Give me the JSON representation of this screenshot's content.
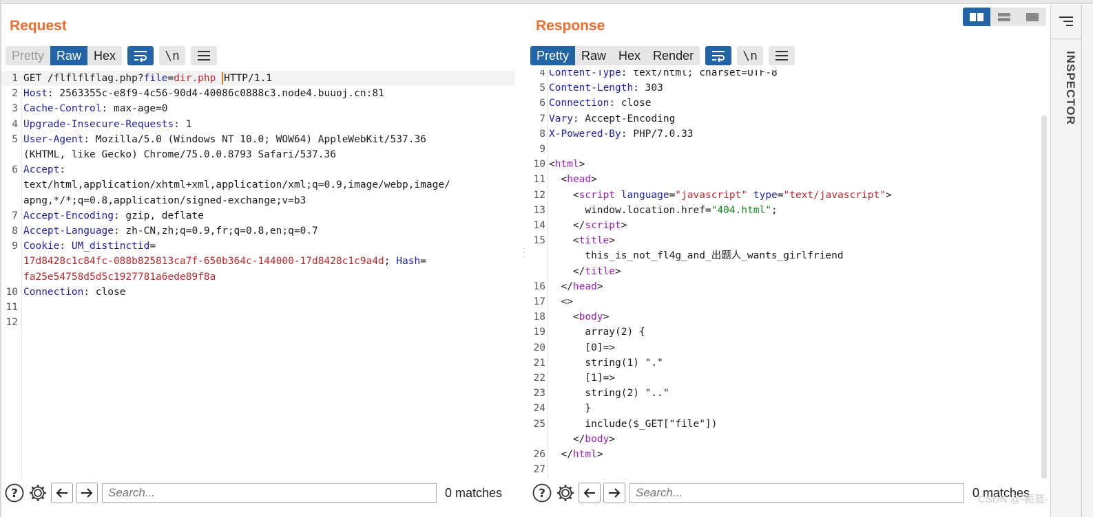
{
  "request": {
    "title": "Request",
    "tabs": [
      "Pretty",
      "Raw",
      "Hex"
    ],
    "active_tab": "Raw",
    "wrap_icon": "wrap-lines-icon",
    "newline_label": "\\n",
    "menu_icon": "hamburger-menu-icon",
    "search_placeholder": "Search...",
    "matches": "0 matches",
    "lines": [
      {
        "n": "1",
        "parts": [
          {
            "c": "",
            "t": "GET /flflflflag.php?"
          },
          {
            "c": "k",
            "t": "file"
          },
          {
            "c": "",
            "t": "="
          },
          {
            "c": "v",
            "t": "dir.php "
          },
          {
            "c": "cursor",
            "t": ""
          },
          {
            "c": "",
            "t": "HTTP/1.1"
          }
        ]
      },
      {
        "n": "2",
        "parts": [
          {
            "c": "k",
            "t": "Host"
          },
          {
            "c": "",
            "t": ": 2563355c-e8f9-4c56-90d4-40086c0888c3.node4.buuoj.cn:81"
          }
        ]
      },
      {
        "n": "3",
        "parts": [
          {
            "c": "k",
            "t": "Cache-Control"
          },
          {
            "c": "",
            "t": ": max-age=0"
          }
        ]
      },
      {
        "n": "4",
        "parts": [
          {
            "c": "k",
            "t": "Upgrade-Insecure-Requests"
          },
          {
            "c": "",
            "t": ": 1"
          }
        ]
      },
      {
        "n": "5",
        "parts": [
          {
            "c": "k",
            "t": "User-Agent"
          },
          {
            "c": "",
            "t": ": Mozilla/5.0 (Windows NT 10.0; WOW64) AppleWebKit/537.36"
          }
        ]
      },
      {
        "n": "",
        "parts": [
          {
            "c": "",
            "t": "(KHTML, like Gecko) Chrome/75.0.0.8793 Safari/537.36"
          }
        ]
      },
      {
        "n": "6",
        "parts": [
          {
            "c": "k",
            "t": "Accept"
          },
          {
            "c": "",
            "t": ":"
          }
        ]
      },
      {
        "n": "",
        "parts": [
          {
            "c": "",
            "t": "text/html,application/xhtml+xml,application/xml;q=0.9,image/webp,image/"
          }
        ]
      },
      {
        "n": "",
        "parts": [
          {
            "c": "",
            "t": "apng,*/*;q=0.8,application/signed-exchange;v=b3"
          }
        ]
      },
      {
        "n": "7",
        "parts": [
          {
            "c": "k",
            "t": "Accept-Encoding"
          },
          {
            "c": "",
            "t": ": gzip, deflate"
          }
        ]
      },
      {
        "n": "8",
        "parts": [
          {
            "c": "k",
            "t": "Accept-Language"
          },
          {
            "c": "",
            "t": ": zh-CN,zh;q=0.9,fr;q=0.8,en;q=0.7"
          }
        ]
      },
      {
        "n": "9",
        "parts": [
          {
            "c": "k",
            "t": "Cookie"
          },
          {
            "c": "",
            "t": ": "
          },
          {
            "c": "k",
            "t": "UM_distinctid"
          },
          {
            "c": "",
            "t": "="
          }
        ]
      },
      {
        "n": "",
        "parts": [
          {
            "c": "v",
            "t": "17d8428c1c84fc-088b825813ca7f-650b364c-144000-17d8428c1c9a4d"
          },
          {
            "c": "",
            "t": "; "
          },
          {
            "c": "k",
            "t": "Hash"
          },
          {
            "c": "",
            "t": "="
          }
        ]
      },
      {
        "n": "",
        "parts": [
          {
            "c": "v",
            "t": "fa25e54758d5d5c1927781a6ede89f8a"
          }
        ]
      },
      {
        "n": "10",
        "parts": [
          {
            "c": "k",
            "t": "Connection"
          },
          {
            "c": "",
            "t": ": close"
          }
        ]
      },
      {
        "n": "11",
        "parts": []
      },
      {
        "n": "12",
        "parts": []
      }
    ]
  },
  "response": {
    "title": "Response",
    "tabs": [
      "Pretty",
      "Raw",
      "Hex",
      "Render"
    ],
    "active_tab": "Pretty",
    "wrap_icon": "wrap-lines-icon",
    "newline_label": "\\n",
    "menu_icon": "hamburger-menu-icon",
    "search_placeholder": "Search...",
    "matches": "0 matches",
    "lines": [
      {
        "n": "4",
        "parts": [
          {
            "c": "k",
            "t": "Content-Type"
          },
          {
            "c": "",
            "t": ": text/html; charset=UTF-8"
          }
        ]
      },
      {
        "n": "5",
        "parts": [
          {
            "c": "k",
            "t": "Content-Length"
          },
          {
            "c": "",
            "t": ": 303"
          }
        ]
      },
      {
        "n": "6",
        "parts": [
          {
            "c": "k",
            "t": "Connection"
          },
          {
            "c": "",
            "t": ": close"
          }
        ]
      },
      {
        "n": "7",
        "parts": [
          {
            "c": "k",
            "t": "Vary"
          },
          {
            "c": "",
            "t": ": Accept-Encoding"
          }
        ]
      },
      {
        "n": "8",
        "parts": [
          {
            "c": "k",
            "t": "X-Powered-By"
          },
          {
            "c": "",
            "t": ": PHP/7.0.33"
          }
        ]
      },
      {
        "n": "9",
        "parts": []
      },
      {
        "n": "10",
        "parts": [
          {
            "c": "",
            "t": "<"
          },
          {
            "c": "t",
            "t": "html"
          },
          {
            "c": "",
            "t": ">"
          }
        ]
      },
      {
        "n": "11",
        "parts": [
          {
            "c": "",
            "t": "  <"
          },
          {
            "c": "t",
            "t": "head"
          },
          {
            "c": "",
            "t": ">"
          }
        ]
      },
      {
        "n": "12",
        "parts": [
          {
            "c": "",
            "t": "    <"
          },
          {
            "c": "t",
            "t": "script"
          },
          {
            "c": "",
            "t": " "
          },
          {
            "c": "k",
            "t": "language"
          },
          {
            "c": "",
            "t": "="
          },
          {
            "c": "v",
            "t": "\"javascript\""
          },
          {
            "c": "",
            "t": " "
          },
          {
            "c": "k",
            "t": "type"
          },
          {
            "c": "",
            "t": "="
          },
          {
            "c": "v",
            "t": "\"text/javascript\""
          },
          {
            "c": "",
            "t": ">"
          }
        ]
      },
      {
        "n": "13",
        "parts": [
          {
            "c": "",
            "t": "      window.location.href="
          },
          {
            "c": "s",
            "t": "\"404.html\""
          },
          {
            "c": "",
            "t": ";"
          }
        ]
      },
      {
        "n": "14",
        "parts": [
          {
            "c": "",
            "t": "    </"
          },
          {
            "c": "t",
            "t": "script"
          },
          {
            "c": "",
            "t": ">"
          }
        ]
      },
      {
        "n": "15",
        "parts": [
          {
            "c": "",
            "t": "    <"
          },
          {
            "c": "t",
            "t": "title"
          },
          {
            "c": "",
            "t": ">"
          }
        ]
      },
      {
        "n": "",
        "parts": [
          {
            "c": "",
            "t": "      this_is_not_fl4g_and_出题人_wants_girlfriend"
          }
        ]
      },
      {
        "n": "",
        "parts": [
          {
            "c": "",
            "t": "    </"
          },
          {
            "c": "t",
            "t": "title"
          },
          {
            "c": "",
            "t": ">"
          }
        ]
      },
      {
        "n": "16",
        "parts": [
          {
            "c": "",
            "t": "  </"
          },
          {
            "c": "t",
            "t": "head"
          },
          {
            "c": "",
            "t": ">"
          }
        ]
      },
      {
        "n": "17",
        "parts": [
          {
            "c": "",
            "t": "  <>"
          }
        ]
      },
      {
        "n": "18",
        "parts": [
          {
            "c": "",
            "t": "    <"
          },
          {
            "c": "t",
            "t": "body"
          },
          {
            "c": "",
            "t": ">"
          }
        ]
      },
      {
        "n": "19",
        "parts": [
          {
            "c": "",
            "t": "      array(2) {"
          }
        ]
      },
      {
        "n": "20",
        "parts": [
          {
            "c": "",
            "t": "      [0]=>"
          }
        ]
      },
      {
        "n": "21",
        "parts": [
          {
            "c": "",
            "t": "      string(1) \".\""
          }
        ]
      },
      {
        "n": "22",
        "parts": [
          {
            "c": "",
            "t": "      [1]=>"
          }
        ]
      },
      {
        "n": "23",
        "parts": [
          {
            "c": "",
            "t": "      string(2) \"..\""
          }
        ]
      },
      {
        "n": "24",
        "parts": [
          {
            "c": "",
            "t": "      }"
          }
        ]
      },
      {
        "n": "25",
        "parts": [
          {
            "c": "",
            "t": "      include($_GET[\"file\"])"
          }
        ]
      },
      {
        "n": "",
        "parts": [
          {
            "c": "",
            "t": "    </"
          },
          {
            "c": "t",
            "t": "body"
          },
          {
            "c": "",
            "t": ">"
          }
        ]
      },
      {
        "n": "26",
        "parts": [
          {
            "c": "",
            "t": "  </"
          },
          {
            "c": "t",
            "t": "html"
          },
          {
            "c": "",
            "t": ">"
          }
        ]
      },
      {
        "n": "27",
        "parts": []
      }
    ]
  },
  "inspector": {
    "label": "INSPECTOR",
    "menu_icon": "menu-lines-icon"
  },
  "layout_buttons": [
    "split-horizontal-icon",
    "split-vertical-icon",
    "single-pane-icon"
  ],
  "colors": {
    "accent_orange": "#ee6d2d",
    "active_blue": "#2364a6",
    "key_blue": "#1d1fae",
    "value_red": "#c0262a",
    "tag_purple": "#9b1fbf",
    "string_green": "#0c8a17"
  },
  "watermark": "CSDN @-栀蓝-"
}
